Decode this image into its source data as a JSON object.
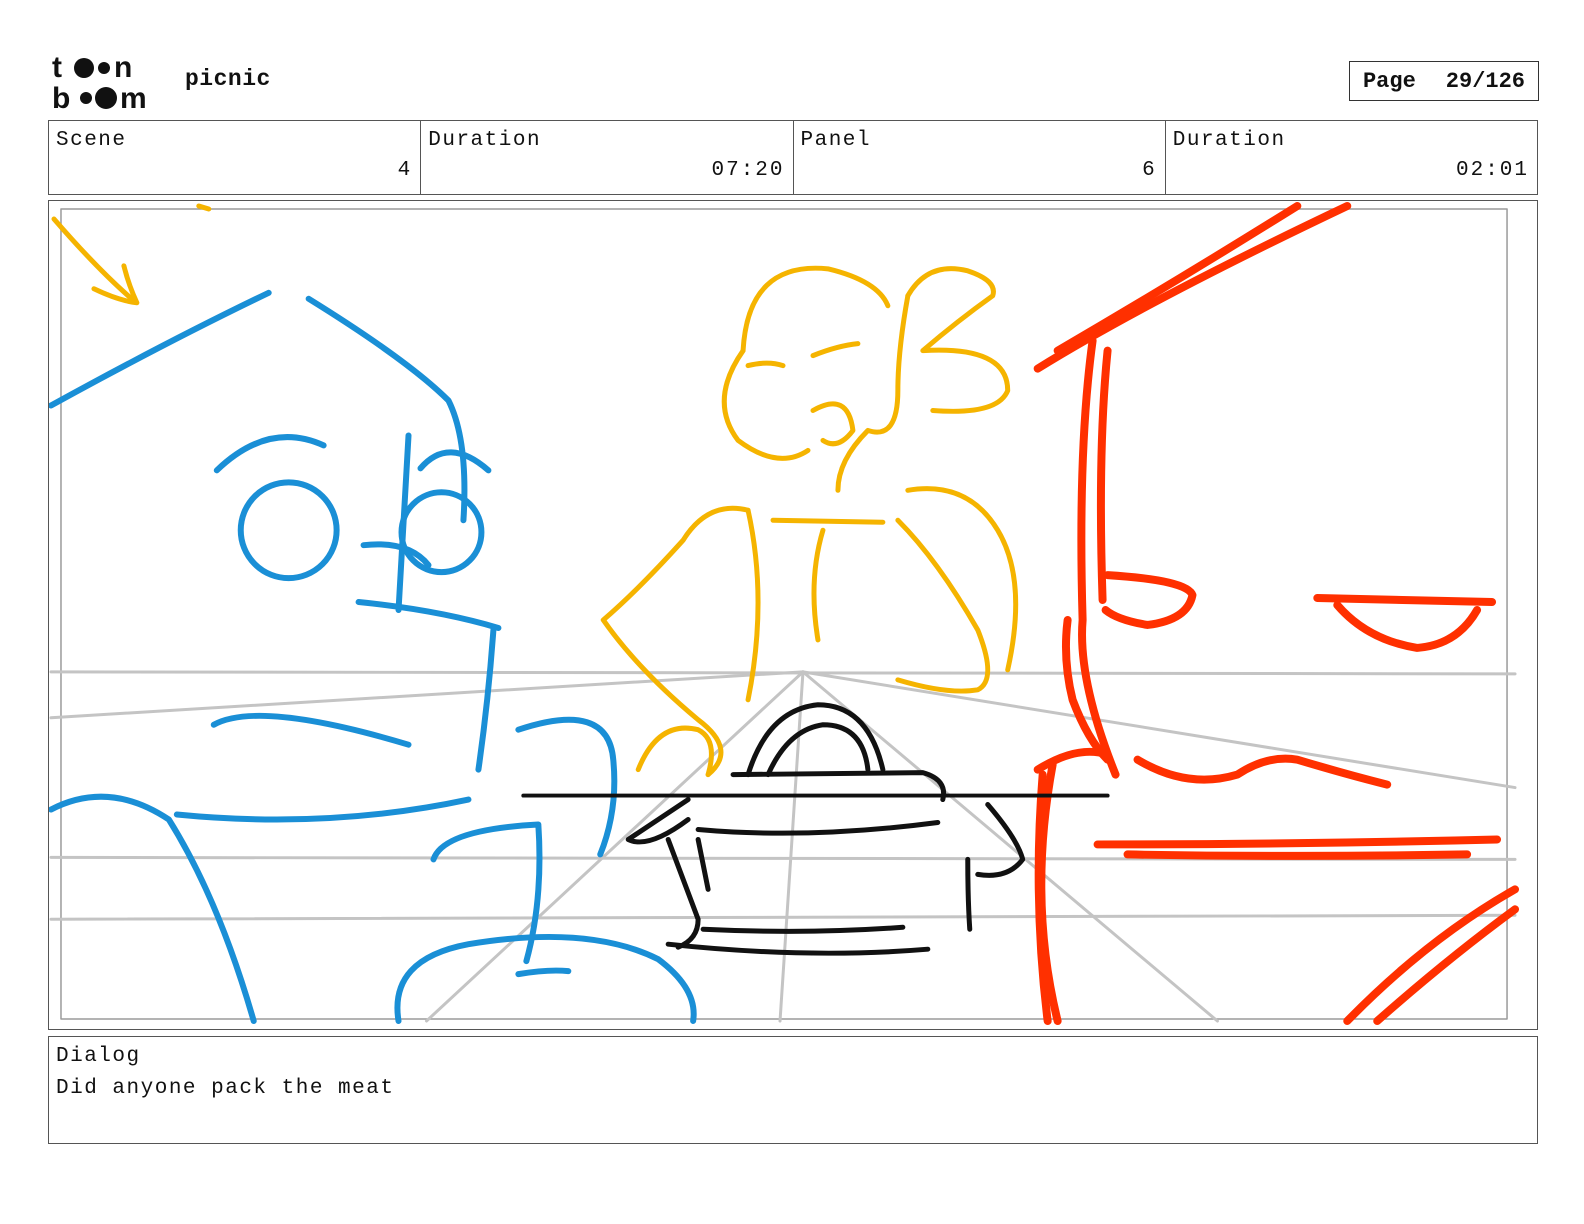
{
  "header": {
    "logo": {
      "icon": "toon-boom-logo",
      "text_line1": "t  n",
      "text_line2": "b  m"
    },
    "project_title": "picnic",
    "page": {
      "label": "Page",
      "value": "29/126"
    }
  },
  "info": {
    "scene": {
      "label": "Scene",
      "value": "4"
    },
    "scene_duration": {
      "label": "Duration",
      "value": "07:20"
    },
    "panel": {
      "label": "Panel",
      "value": "6"
    },
    "panel_duration": {
      "label": "Duration",
      "value": "02:01"
    }
  },
  "panel_image": {
    "icon": "storyboard-sketch",
    "colors": {
      "blue": "#1a8fd6",
      "yellow": "#f5b400",
      "red": "#ff3000",
      "black": "#111111",
      "guide": "#c4c4c4"
    }
  },
  "dialog": {
    "label": "Dialog",
    "text": "Did anyone pack the meat"
  }
}
